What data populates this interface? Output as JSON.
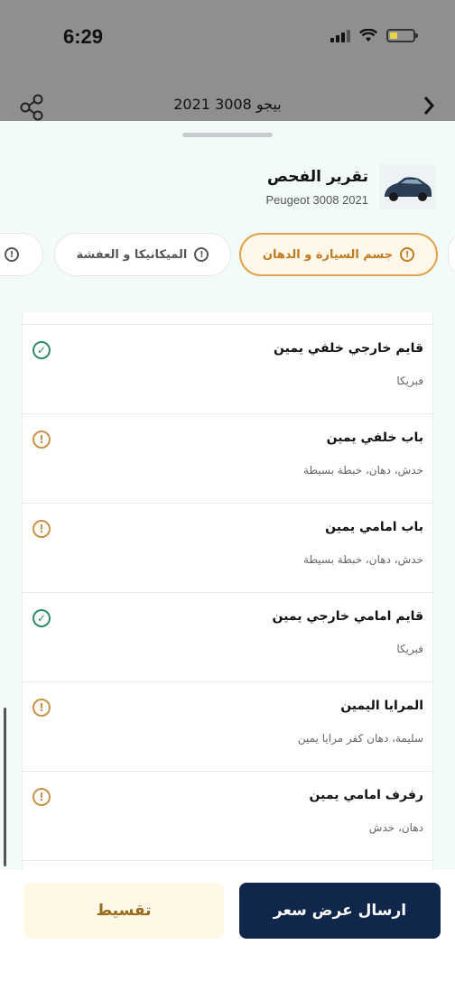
{
  "status_bar": {
    "time": "6:29"
  },
  "header": {
    "title": "بيجو 3008 2021"
  },
  "report": {
    "title": "تقرير الفحص",
    "subtitle": "Peugeot 3008 2021"
  },
  "tabs": [
    {
      "label": "جسم السيارة و الدهان",
      "active": true
    },
    {
      "label": "الميكانيكا و العفشة",
      "active": false
    },
    {
      "label": "",
      "active": false
    }
  ],
  "inspection_items": [
    {
      "title": "قايم خارجي خلفي يمين",
      "description": "فبريكا",
      "status": "ok"
    },
    {
      "title": "باب خلفي يمين",
      "description": "خدش، دهان، خبطة بسيطة",
      "status": "warning"
    },
    {
      "title": "باب امامي يمين",
      "description": "خدش، دهان، خبطة بسيطة",
      "status": "warning"
    },
    {
      "title": "قايم امامي خارجي يمين",
      "description": "فبريكا",
      "status": "ok"
    },
    {
      "title": "المرايا اليمين",
      "description": "سليمة، دهان كفر مرايا يمين",
      "status": "warning"
    },
    {
      "title": "رفرف امامي يمين",
      "description": "دهان، خدش",
      "status": "warning"
    }
  ],
  "actions": {
    "send_offer": "ارسال عرض سعر",
    "installment": "تقسيط"
  },
  "colors": {
    "navy": "#10264a",
    "accent": "#e0a24d",
    "ok": "#2f8c63",
    "warning": "#c9924a"
  }
}
